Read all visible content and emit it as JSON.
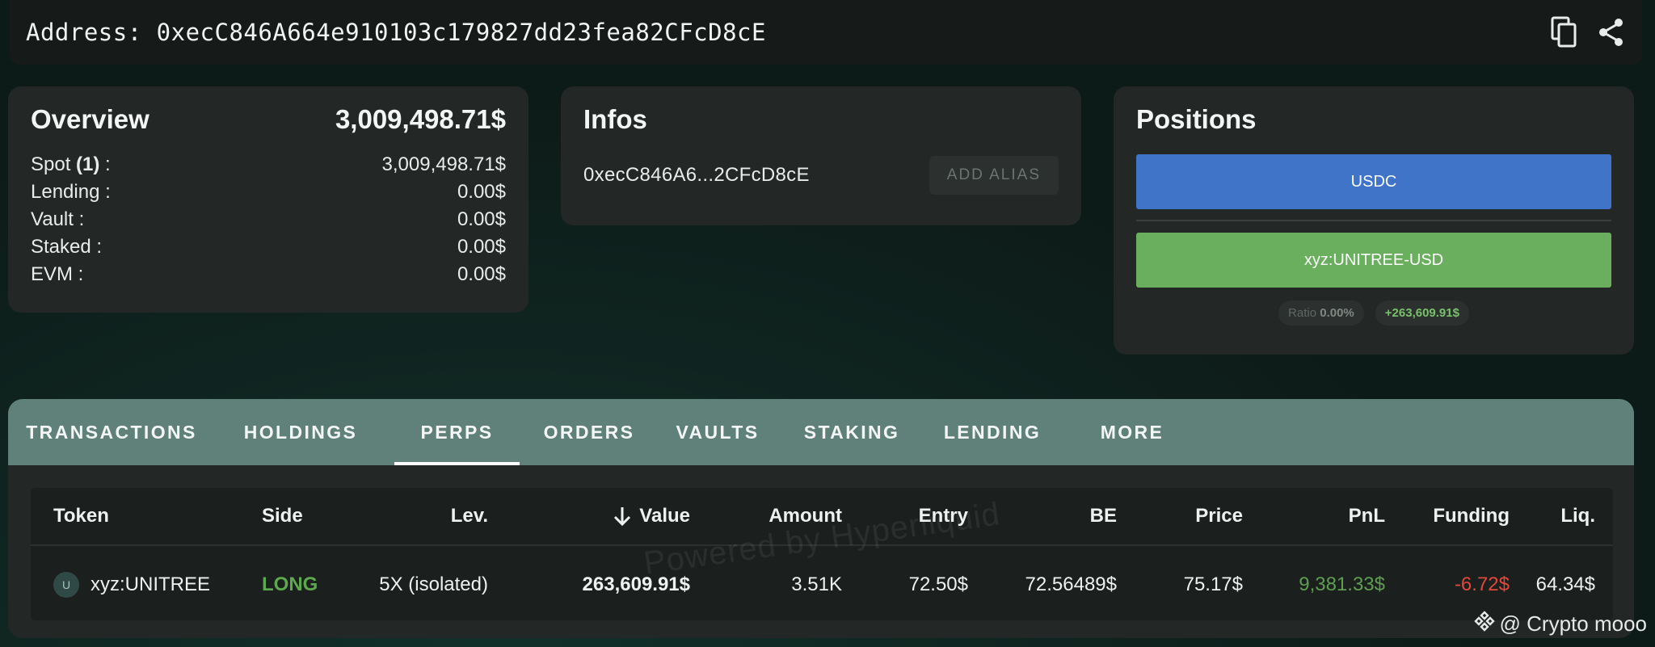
{
  "address_bar": {
    "label": "Address:",
    "value": "0xecC846A664e910103c179827dd23fea82CFcD8cE",
    "icons": [
      "copy-icon",
      "share-icon"
    ]
  },
  "overview": {
    "title": "Overview",
    "total": "3,009,498.71$",
    "rows": [
      {
        "label": "Spot ",
        "count": "(1)",
        "suffix": " :",
        "value": "3,009,498.71$"
      },
      {
        "label": "Lending :",
        "value": "0.00$"
      },
      {
        "label": "Vault :",
        "value": "0.00$"
      },
      {
        "label": "Staked :",
        "value": "0.00$"
      },
      {
        "label": "EVM :",
        "value": "0.00$"
      }
    ]
  },
  "infos": {
    "title": "Infos",
    "short_address": "0xecC846A6...2CFcD8cE",
    "alias_button": "ADD ALIAS"
  },
  "positions": {
    "title": "Positions",
    "items": [
      "USDC",
      "xyz:UNITREE-USD"
    ],
    "ratio_label": "Ratio",
    "ratio_value": "0.00%",
    "pnl": "+263,609.91$",
    "colors": {
      "usdc": "#3f74c9",
      "xyz": "#6aaf5e"
    }
  },
  "tabs": [
    "TRANSACTIONS",
    "HOLDINGS",
    "PERPS",
    "ORDERS",
    "VAULTS",
    "STAKING",
    "LENDING",
    "MORE"
  ],
  "active_tab": "PERPS",
  "table": {
    "headers": [
      "Token",
      "Side",
      "Lev.",
      "Value",
      "Amount",
      "Entry",
      "BE",
      "Price",
      "PnL",
      "Funding",
      "Liq."
    ],
    "sort_icon": "arrow-down-icon",
    "rows": [
      {
        "icon_letter": "U",
        "token": "xyz:UNITREE",
        "side": "LONG",
        "lev": "5X (isolated)",
        "value": "263,609.91$",
        "amount": "3.51K",
        "entry": "72.50$",
        "be": "72.56489$",
        "price": "75.17$",
        "pnl": "9,381.33$",
        "funding": "-6.72$",
        "liq": "64.34$"
      }
    ]
  },
  "watermark": "Powered by Hyperliquid",
  "credit": "@ Crypto mooo"
}
